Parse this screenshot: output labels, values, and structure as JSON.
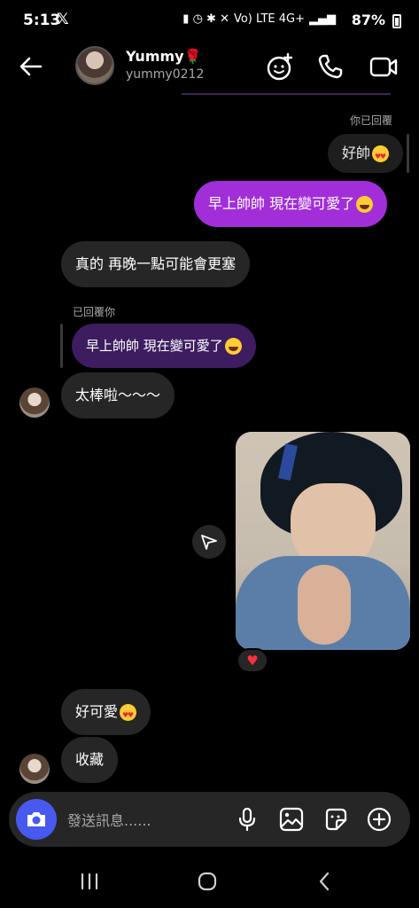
{
  "status_bar": {
    "time": "5:13",
    "app_badge": "𝕏",
    "network": "Vo) LTE 4G+",
    "battery": "87%"
  },
  "header": {
    "name": "Yummy",
    "name_emoji": "🌹",
    "username": "yummy0212"
  },
  "messages": {
    "reply_label_you": "你已回覆",
    "quoted_you": "好帥",
    "sent_1": "早上帥帥 現在變可愛了",
    "recv_1": "真的 再晚一點可能會更塞",
    "reply_label_them": "已回覆你",
    "quoted_them": "早上帥帥 現在變可愛了",
    "recv_2": "太棒啦～～～",
    "reaction": "♥",
    "recv_3": "好可愛",
    "recv_4": "收藏"
  },
  "composer": {
    "placeholder": "發送訊息......"
  },
  "colors": {
    "sent_bubble": "#a12ed8",
    "received_bubble": "#262626",
    "camera_button": "#4859f0",
    "reaction_heart": "#ff3040"
  },
  "icons": [
    "back-arrow-icon",
    "effects-icon",
    "phone-icon",
    "video-call-icon",
    "share-icon",
    "camera-icon",
    "microphone-icon",
    "gallery-icon",
    "sticker-icon",
    "plus-icon",
    "recent-apps-icon",
    "home-icon",
    "back-nav-icon"
  ]
}
